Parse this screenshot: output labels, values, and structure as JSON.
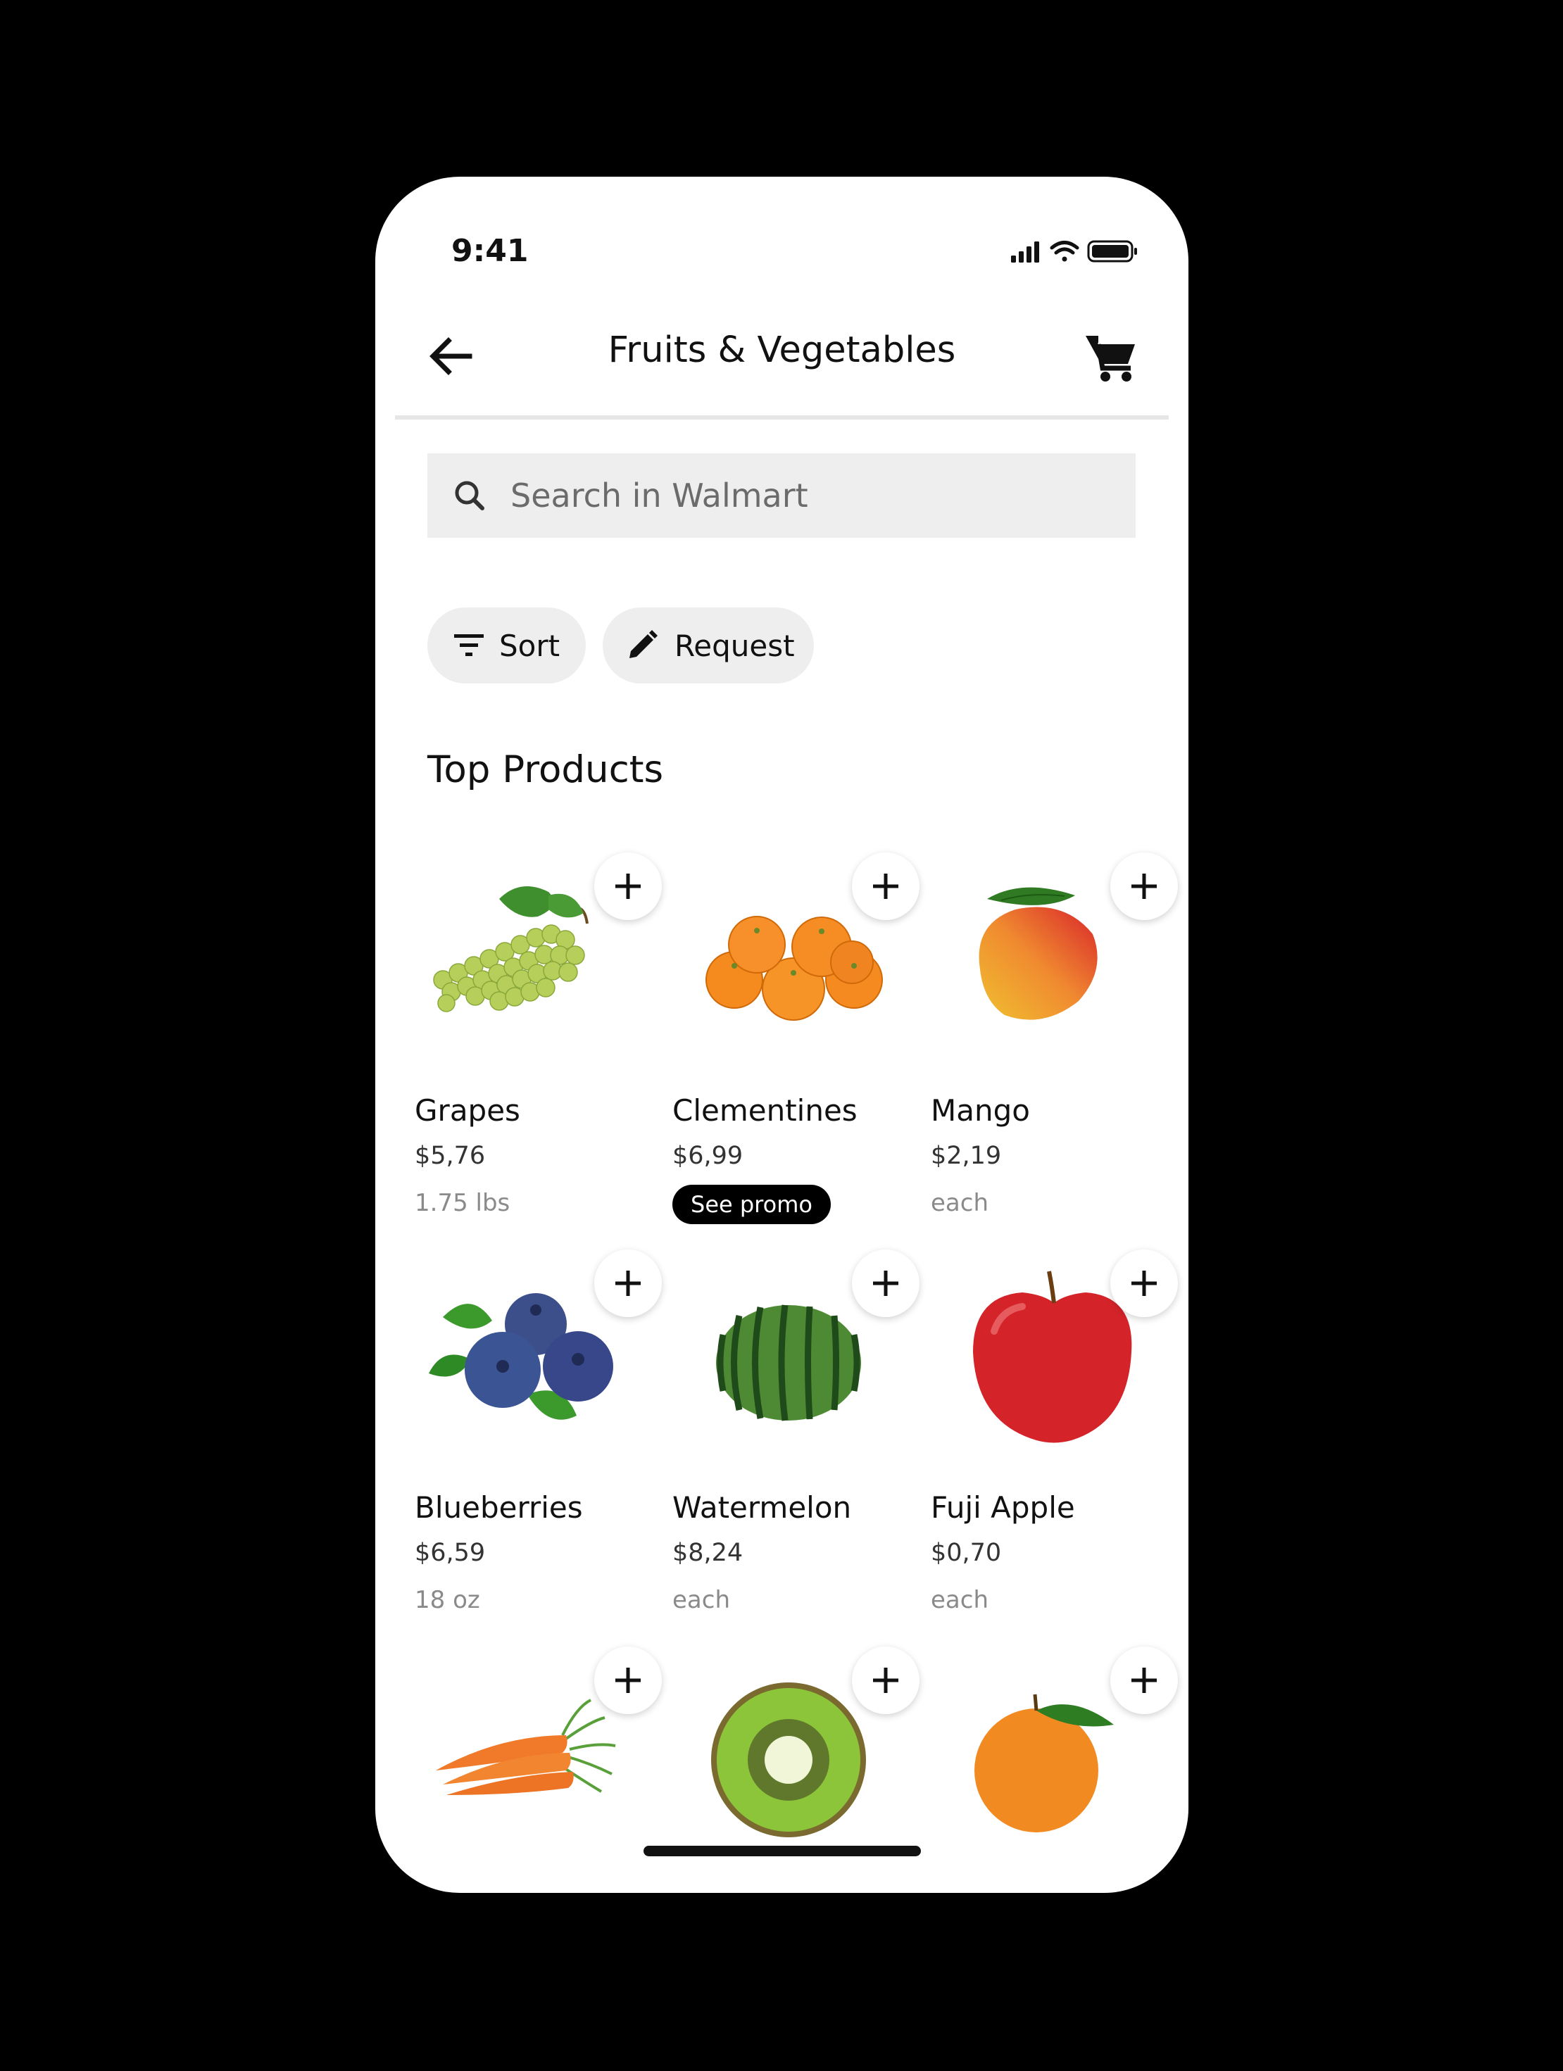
{
  "status_bar": {
    "time": "9:41"
  },
  "header": {
    "title": "Fruits & Vegetables"
  },
  "search": {
    "placeholder": "Search in Walmart"
  },
  "filters": {
    "sort_label": "Sort",
    "request_label": "Request"
  },
  "section": {
    "title": "Top Products"
  },
  "products": [
    {
      "name": "Grapes",
      "price": "$5,76",
      "unit": "1.75 lbs"
    },
    {
      "name": "Clementines",
      "price": "$6,99",
      "promo": "See promo"
    },
    {
      "name": "Mango",
      "price": "$2,19",
      "unit": "each"
    },
    {
      "name": "Blueberries",
      "price": "$6,59",
      "unit": "18 oz"
    },
    {
      "name": "Watermelon",
      "price": "$8,24",
      "unit": "each"
    },
    {
      "name": "Fuji Apple",
      "price": "$0,70",
      "unit": "each"
    },
    {
      "image": "carrots"
    },
    {
      "image": "kiwi"
    },
    {
      "image": "tangerine"
    }
  ]
}
